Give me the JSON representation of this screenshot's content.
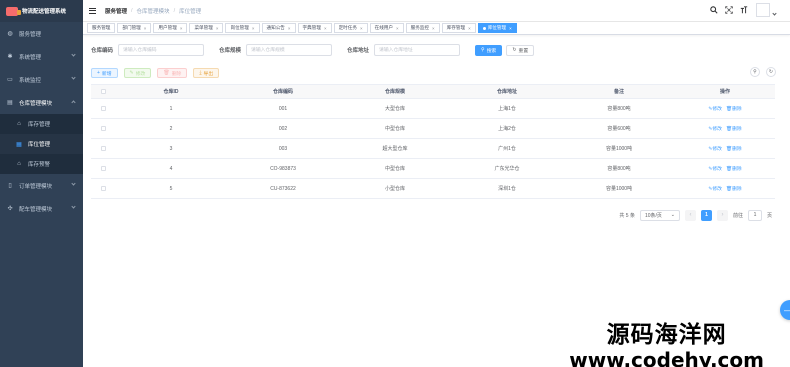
{
  "app": {
    "title": "物流配送管理系统"
  },
  "sidebar": {
    "items": [
      {
        "label": "服务管理",
        "icon": "dashboard-icon",
        "glyph": "◍"
      },
      {
        "label": "系统管理",
        "icon": "gear-icon",
        "glyph": "✱"
      },
      {
        "label": "系统监控",
        "icon": "monitor-icon",
        "glyph": "▭"
      },
      {
        "label": "仓库管理模块",
        "icon": "warehouse-icon",
        "glyph": "▤"
      },
      {
        "label": "订单管理模块",
        "icon": "order-icon",
        "glyph": "▯"
      },
      {
        "label": "配车管理模块",
        "icon": "truck-icon",
        "glyph": "✣"
      }
    ],
    "sub_items": [
      {
        "label": "库存管理",
        "icon": "inventory-icon",
        "glyph": "⌂"
      },
      {
        "label": "库位管理",
        "icon": "location-icon",
        "glyph": "▦"
      },
      {
        "label": "库存预警",
        "icon": "alert-icon",
        "glyph": "⌂"
      }
    ]
  },
  "navbar": {
    "breadcrumb": [
      "服务管理",
      "仓库管理模块",
      "库位管理"
    ]
  },
  "tags": [
    {
      "label": "服务管理"
    },
    {
      "label": "部门管理"
    },
    {
      "label": "用户管理"
    },
    {
      "label": "菜单管理"
    },
    {
      "label": "岗位管理"
    },
    {
      "label": "通知公告"
    },
    {
      "label": "字典管理"
    },
    {
      "label": "定时任务"
    },
    {
      "label": "在线用户"
    },
    {
      "label": "服务监控"
    },
    {
      "label": "库存管理"
    },
    {
      "label": "库位管理"
    }
  ],
  "search": {
    "code_label": "仓库编码",
    "code_placeholder": "请输入仓库编码",
    "scale_label": "仓库规模",
    "scale_placeholder": "请输入仓库规模",
    "addr_label": "仓库地址",
    "addr_placeholder": "请输入仓库地址",
    "search_btn": "搜索",
    "reset_btn": "重置"
  },
  "toolbar": {
    "add": "新增",
    "edit": "修改",
    "delete": "删除",
    "export": "导出"
  },
  "table": {
    "headers": [
      "仓库ID",
      "仓库编码",
      "仓库规模",
      "仓库地址",
      "备注",
      "操作"
    ],
    "rows": [
      {
        "id": "1",
        "code": "001",
        "scale": "大型仓库",
        "addr": "上海1仓",
        "remark": "容量800吨"
      },
      {
        "id": "2",
        "code": "002",
        "scale": "中型仓库",
        "addr": "上海2仓",
        "remark": "容量600吨"
      },
      {
        "id": "3",
        "code": "003",
        "scale": "超大型仓库",
        "addr": "广州1仓",
        "remark": "容量1000吨"
      },
      {
        "id": "4",
        "code": "CO-983873",
        "scale": "中型仓库",
        "addr": "广东光华仓",
        "remark": "容量800吨"
      },
      {
        "id": "5",
        "code": "CU-873622",
        "scale": "小型仓库",
        "addr": "深圳1仓",
        "remark": "容量1000吨"
      }
    ],
    "op_edit": "修改",
    "op_delete": "删除"
  },
  "pager": {
    "total": "共 5 条",
    "size": "10条/页",
    "current": "1",
    "goto": "前往",
    "goto_value": "1",
    "page_unit": "页"
  },
  "watermark": {
    "line1": "源码海洋网",
    "line2": "www.codehy.com"
  },
  "colors": {
    "sidebar_bg": "#304156",
    "primary": "#409eff"
  }
}
